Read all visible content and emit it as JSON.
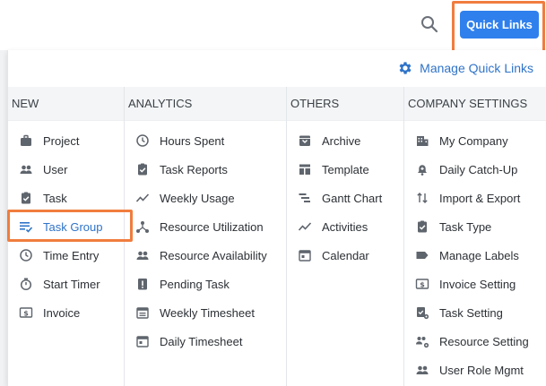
{
  "header": {
    "quick_links_label": "Quick Links"
  },
  "panel": {
    "manage_label": "Manage Quick Links"
  },
  "columns": [
    {
      "title": "NEW",
      "items": [
        {
          "label": "Project",
          "icon": "briefcase-icon"
        },
        {
          "label": "User",
          "icon": "users-icon"
        },
        {
          "label": "Task",
          "icon": "clipboard-check-icon"
        },
        {
          "label": "Task Group",
          "icon": "list-check-icon",
          "active": true
        },
        {
          "label": "Time Entry",
          "icon": "clock-icon"
        },
        {
          "label": "Start Timer",
          "icon": "stopwatch-icon"
        },
        {
          "label": "Invoice",
          "icon": "invoice-dollar-icon"
        }
      ]
    },
    {
      "title": "ANALYTICS",
      "items": [
        {
          "label": "Hours Spent",
          "icon": "clock-icon"
        },
        {
          "label": "Task Reports",
          "icon": "clipboard-check-icon"
        },
        {
          "label": "Weekly Usage",
          "icon": "trend-line-icon"
        },
        {
          "label": "Resource Utilization",
          "icon": "network-icon"
        },
        {
          "label": "Resource Availability",
          "icon": "users-icon"
        },
        {
          "label": "Pending Task",
          "icon": "alert-clipboard-icon"
        },
        {
          "label": "Weekly Timesheet",
          "icon": "calendar-list-icon"
        },
        {
          "label": "Daily Timesheet",
          "icon": "calendar-day-icon"
        }
      ]
    },
    {
      "title": "OTHERS",
      "items": [
        {
          "label": "Archive",
          "icon": "archive-icon"
        },
        {
          "label": "Template",
          "icon": "template-icon"
        },
        {
          "label": "Gantt Chart",
          "icon": "gantt-icon"
        },
        {
          "label": "Activities",
          "icon": "trend-line-icon"
        },
        {
          "label": "Calendar",
          "icon": "calendar-day-icon"
        }
      ]
    },
    {
      "title": "COMPANY SETTINGS",
      "items": [
        {
          "label": "My Company",
          "icon": "building-icon"
        },
        {
          "label": "Daily Catch-Up",
          "icon": "bell-plus-icon"
        },
        {
          "label": "Import & Export",
          "icon": "swap-vertical-icon"
        },
        {
          "label": "Task Type",
          "icon": "clipboard-check-icon"
        },
        {
          "label": "Manage Labels",
          "icon": "label-icon"
        },
        {
          "label": "Invoice Setting",
          "icon": "invoice-dollar-icon"
        },
        {
          "label": "Task Setting",
          "icon": "clipboard-gear-icon"
        },
        {
          "label": "Resource Setting",
          "icon": "users-gear-icon"
        },
        {
          "label": "User Role Mgmt",
          "icon": "users-icon"
        }
      ]
    }
  ],
  "colors": {
    "accent": "#2f80ed",
    "highlight": "#f07d3e",
    "link": "#2f73c8"
  }
}
